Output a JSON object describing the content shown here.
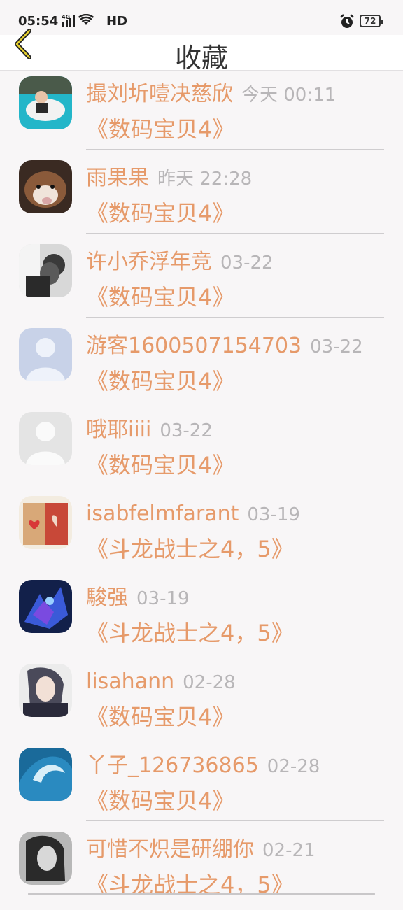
{
  "status_bar": {
    "time": "05:54",
    "network": "4G",
    "hd": "HD",
    "battery": "72"
  },
  "header": {
    "title": "收藏",
    "back_icon": "chevron-left-icon"
  },
  "colors": {
    "accent": "#e69a6a",
    "time_gray": "#b8b6b8",
    "background": "#f8f6f7"
  },
  "favorites": [
    {
      "user": "撮刘圻噎决慈欣",
      "time": "今天 00:11",
      "title": "《数码宝贝4》"
    },
    {
      "user": "雨果果",
      "time": "昨天 22:28",
      "title": "《数码宝贝4》"
    },
    {
      "user": "许小乔浮年竞",
      "time": "03-22",
      "title": "《数码宝贝4》"
    },
    {
      "user": "游客1600507154703",
      "time": "03-22",
      "title": "《数码宝贝4》"
    },
    {
      "user": "哦耶iiii",
      "time": "03-22",
      "title": "《数码宝贝4》"
    },
    {
      "user": "isabfelmfarant",
      "time": "03-19",
      "title": "《斗龙战士之4，5》"
    },
    {
      "user": "駿强",
      "time": "03-19",
      "title": "《斗龙战士之4，5》"
    },
    {
      "user": "lisahann",
      "time": "02-28",
      "title": "《数码宝贝4》"
    },
    {
      "user": "丫子_126736865",
      "time": "02-28",
      "title": "《数码宝贝4》"
    },
    {
      "user": "可惜不炽是研绷你",
      "time": "02-21",
      "title": "《斗龙战士之4，5》"
    }
  ]
}
